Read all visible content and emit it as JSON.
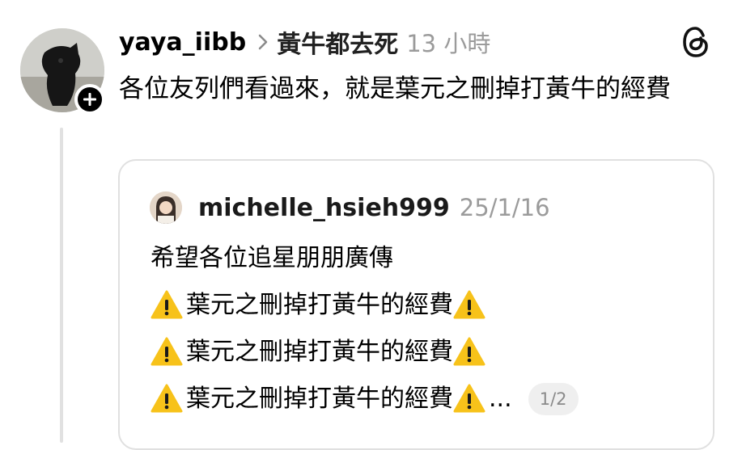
{
  "post": {
    "username": "yaya_iibb",
    "topic": "黃牛都去死",
    "time": "13 小時",
    "text": "各位友列們看過來，就是葉元之刪掉打黃牛的經費"
  },
  "quote": {
    "username": "michelle_hsieh999",
    "date": "25/1/16",
    "line1": "希望各位追星朋朋廣傳",
    "line2": "葉元之刪掉打黃牛的經費",
    "line3": "葉元之刪掉打黃牛的經費",
    "line4": "葉元之刪掉打黃牛的經費",
    "ellipsis": "...",
    "pager": "1/2"
  },
  "icons": {
    "chevron": "chevron-right-icon",
    "threads": "threads-logo-icon",
    "follow": "plus-icon",
    "warning": "warning-icon"
  },
  "colors": {
    "warning_yellow": "#f7c21a",
    "muted_text": "#9b9b9b",
    "border": "#e0e0e0"
  }
}
